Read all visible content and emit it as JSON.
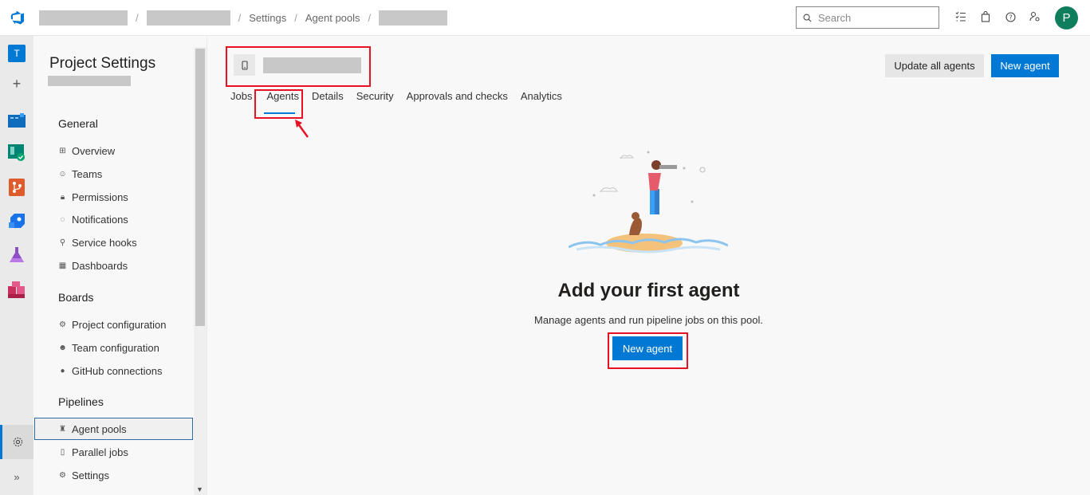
{
  "header": {
    "breadcrumbs": [
      "Settings",
      "Agent pools"
    ],
    "search_placeholder": "Search",
    "avatar_initial": "P"
  },
  "rail": {
    "project_initial": "T"
  },
  "settings_nav": {
    "title": "Project Settings",
    "groups": [
      {
        "label": "General",
        "items": [
          "Overview",
          "Teams",
          "Permissions",
          "Notifications",
          "Service hooks",
          "Dashboards"
        ]
      },
      {
        "label": "Boards",
        "items": [
          "Project configuration",
          "Team configuration",
          "GitHub connections"
        ]
      },
      {
        "label": "Pipelines",
        "items": [
          "Agent pools",
          "Parallel jobs",
          "Settings"
        ]
      }
    ],
    "selected_item": "Agent pools"
  },
  "main": {
    "buttons": {
      "update_all": "Update all agents",
      "new_agent": "New agent"
    },
    "tabs": [
      "Jobs",
      "Agents",
      "Details",
      "Security",
      "Approvals and checks",
      "Analytics"
    ],
    "active_tab": "Agents",
    "empty_state": {
      "title": "Add your first agent",
      "description": "Manage agents and run pipeline jobs on this pool.",
      "button": "New agent"
    }
  },
  "colors": {
    "accent": "#0078d4",
    "highlight": "#e81123",
    "avatar": "#0f7e5d"
  }
}
